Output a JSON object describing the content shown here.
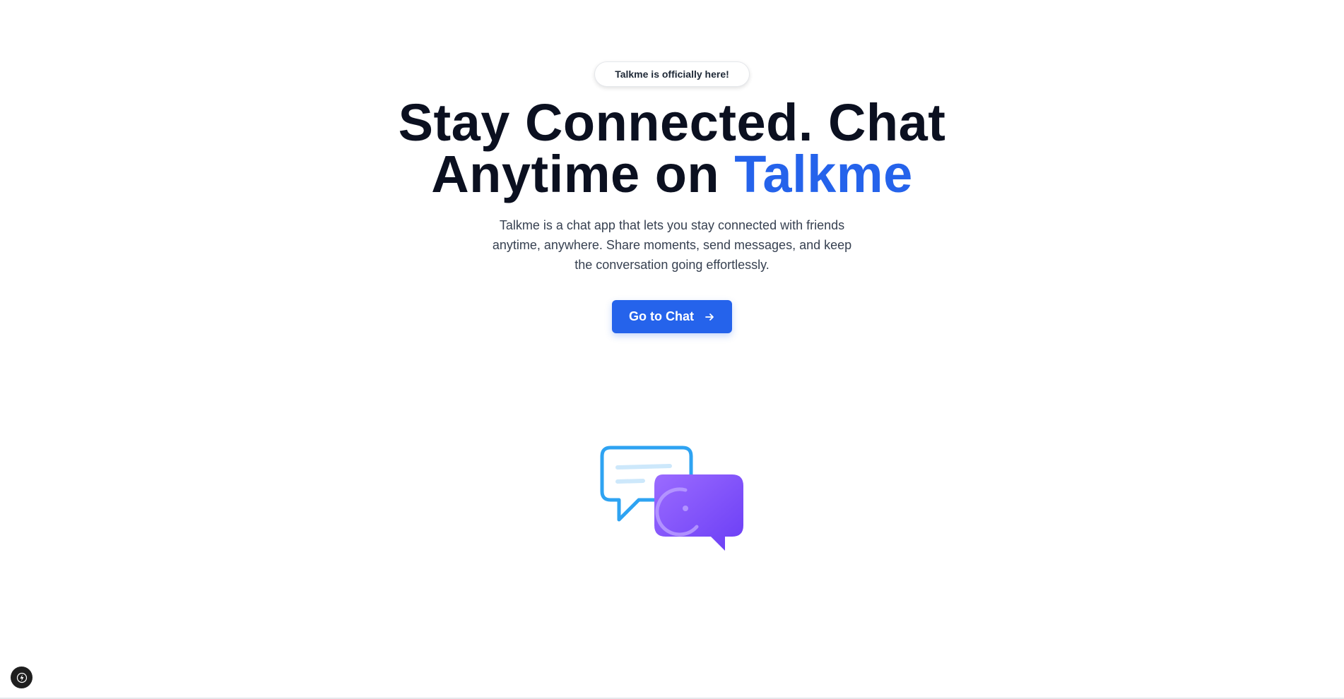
{
  "badge": {
    "text": "Talkme is officially here!"
  },
  "hero": {
    "headline_line1": "Stay Connected. Chat",
    "headline_line2_prefix": "Anytime on ",
    "headline_brand": "Talkme",
    "subtitle": "Talkme is a chat app that lets you stay connected with friends anytime, anywhere. Share moments, send messages, and keep the conversation going effortlessly."
  },
  "cta": {
    "label": "Go to Chat",
    "icon": "arrow-right-icon"
  },
  "illustration": {
    "icon": "chat-bubbles-icon"
  },
  "dev_tools": {
    "icon": "lightning-bolt-icon"
  },
  "colors": {
    "accent": "#2563eb",
    "heading": "#0b1020",
    "body_text": "#374151",
    "bubble_blue": "#2ea3f2",
    "bubble_purple": "#7c4dff"
  }
}
